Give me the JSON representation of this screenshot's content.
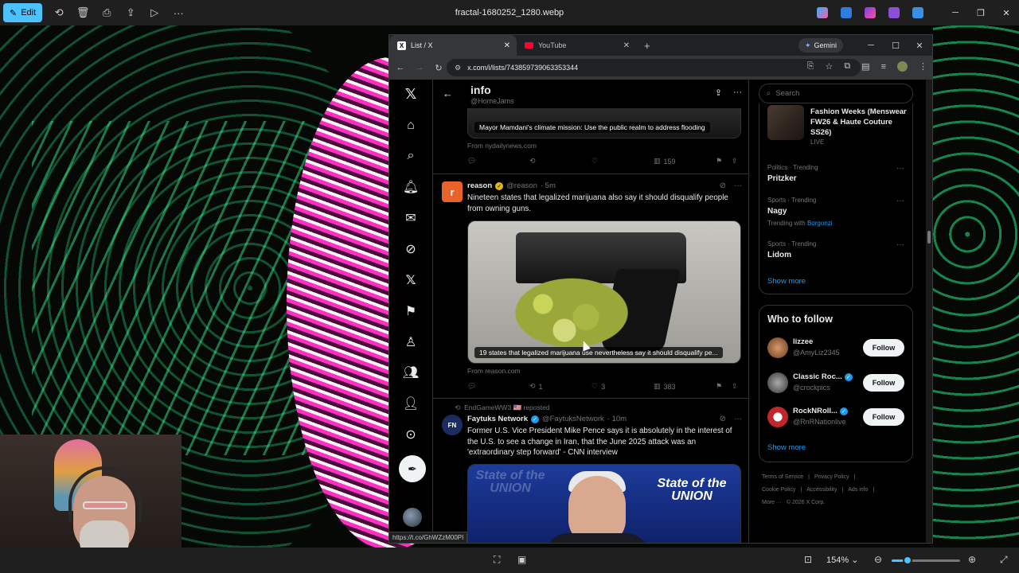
{
  "viewer": {
    "edit_label": "Edit",
    "file_title": "fractal-1680252_1280.webp",
    "toolbar_icons": [
      "rotate-icon",
      "delete-icon",
      "print-icon",
      "share-icon",
      "slideshow-icon",
      "more-icon"
    ],
    "zoom_label": "154%",
    "zoom_fraction": 0.2
  },
  "browser": {
    "tabs": [
      {
        "label": "List / X",
        "icon": "x-logo-icon"
      },
      {
        "label": "YouTube",
        "icon": "youtube-icon"
      }
    ],
    "gemini_label": "Gemini",
    "url": "x.com/i/lists/743859739063353344",
    "status_url": "https://t.co/GhWZzM00PI"
  },
  "x": {
    "list_title": "info",
    "list_handle": "@HomeJams",
    "post1": {
      "caption": "Mayor Mamdani's climate mission: Use the public realm to address flooding",
      "from": "From nydailynews.com",
      "views": "159"
    },
    "post2": {
      "avatar_letter": "r",
      "name": "reason",
      "handle": "@reason",
      "time": "· 5m",
      "text": "Nineteen states that legalized marijuana also say it should disqualify people from owning guns.",
      "caption": "19 states that legalized marijuana use nevertheless say it should disqualify pe...",
      "from": "From reason.com",
      "reposts": "1",
      "likes": "3",
      "views": "383"
    },
    "post3": {
      "reposted_by": "EndGameWW3 🇺🇸 reposted",
      "name": "Faytuks Network",
      "handle": "@FaytuksNetwork",
      "time": "· 10m",
      "text": "Former U.S. Vice President Mike Pence says it is absolutely in the interest of the U.S. to see a change in Iran, that the June 2025 attack was an 'extraordinary step forward' - CNN interview",
      "banner_left": "State of the UNION",
      "banner_right": "State of the UNION"
    }
  },
  "sidebar": {
    "search_placeholder": "Search",
    "event": {
      "title": "Fashion Weeks (Menswear FW26 & Haute Couture SS26)",
      "status": "LIVE"
    },
    "trends": [
      {
        "meta": "Politics · Trending",
        "name": "Pritzker"
      },
      {
        "meta": "Sports · Trending",
        "name": "Nagy",
        "with_label": "Trending with",
        "with": "Borgonzi"
      },
      {
        "meta": "Sports · Trending",
        "name": "Lidom"
      }
    ],
    "trends_show_more": "Show more",
    "who_to_follow": {
      "title": "Who to follow",
      "follow_label": "Follow",
      "users": [
        {
          "name": "lizzee",
          "handle": "@AmyLiz2345",
          "verified": false
        },
        {
          "name": "Classic Roc...",
          "handle": "@crockpics",
          "verified": true
        },
        {
          "name": "RockNRoll...",
          "handle": "@RnRNationlive",
          "verified": true
        }
      ],
      "show_more": "Show more"
    },
    "footer": [
      "Terms of Service",
      "|",
      "Privacy Policy",
      "|",
      "Cookie Policy",
      "|",
      "Accessibility",
      "|",
      "Ads info",
      "|",
      "More ···",
      "© 2026 X Corp."
    ]
  }
}
